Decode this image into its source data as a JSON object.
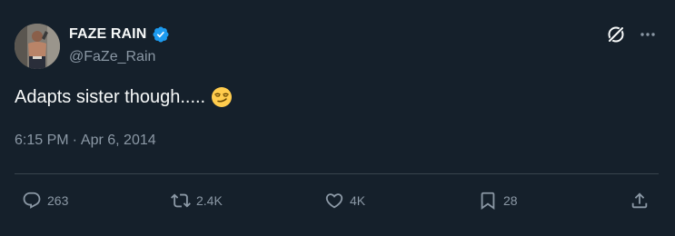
{
  "author": {
    "display_name": "FAZE RAIN",
    "handle": "@FaZe_Rain",
    "verified": true
  },
  "tweet": {
    "text": "Adapts sister though.....",
    "emoji": "smirking-face"
  },
  "meta": {
    "time": "6:15 PM",
    "separator": "·",
    "date": "Apr 6, 2014"
  },
  "actions": {
    "replies": "263",
    "retweets": "2.4K",
    "likes": "4K",
    "bookmarks": "28"
  },
  "colors": {
    "background": "#15202b",
    "text": "#f7f9f9",
    "secondary": "#8b98a5",
    "verified": "#1d9bf0",
    "divider": "#38444d"
  }
}
